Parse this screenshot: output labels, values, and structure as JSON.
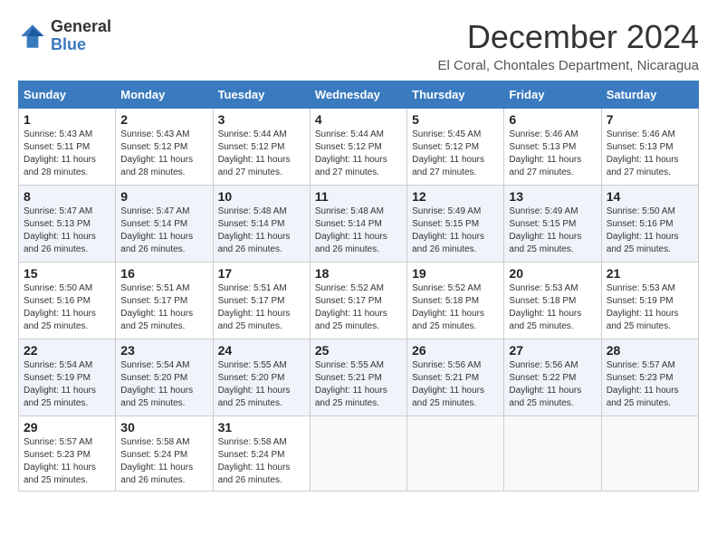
{
  "logo": {
    "general": "General",
    "blue": "Blue"
  },
  "title": "December 2024",
  "location": "El Coral, Chontales Department, Nicaragua",
  "days_of_week": [
    "Sunday",
    "Monday",
    "Tuesday",
    "Wednesday",
    "Thursday",
    "Friday",
    "Saturday"
  ],
  "weeks": [
    [
      {
        "day": "1",
        "sunrise": "5:43 AM",
        "sunset": "5:11 PM",
        "daylight": "11 hours and 28 minutes."
      },
      {
        "day": "2",
        "sunrise": "5:43 AM",
        "sunset": "5:12 PM",
        "daylight": "11 hours and 28 minutes."
      },
      {
        "day": "3",
        "sunrise": "5:44 AM",
        "sunset": "5:12 PM",
        "daylight": "11 hours and 27 minutes."
      },
      {
        "day": "4",
        "sunrise": "5:44 AM",
        "sunset": "5:12 PM",
        "daylight": "11 hours and 27 minutes."
      },
      {
        "day": "5",
        "sunrise": "5:45 AM",
        "sunset": "5:12 PM",
        "daylight": "11 hours and 27 minutes."
      },
      {
        "day": "6",
        "sunrise": "5:46 AM",
        "sunset": "5:13 PM",
        "daylight": "11 hours and 27 minutes."
      },
      {
        "day": "7",
        "sunrise": "5:46 AM",
        "sunset": "5:13 PM",
        "daylight": "11 hours and 27 minutes."
      }
    ],
    [
      {
        "day": "8",
        "sunrise": "5:47 AM",
        "sunset": "5:13 PM",
        "daylight": "11 hours and 26 minutes."
      },
      {
        "day": "9",
        "sunrise": "5:47 AM",
        "sunset": "5:14 PM",
        "daylight": "11 hours and 26 minutes."
      },
      {
        "day": "10",
        "sunrise": "5:48 AM",
        "sunset": "5:14 PM",
        "daylight": "11 hours and 26 minutes."
      },
      {
        "day": "11",
        "sunrise": "5:48 AM",
        "sunset": "5:14 PM",
        "daylight": "11 hours and 26 minutes."
      },
      {
        "day": "12",
        "sunrise": "5:49 AM",
        "sunset": "5:15 PM",
        "daylight": "11 hours and 26 minutes."
      },
      {
        "day": "13",
        "sunrise": "5:49 AM",
        "sunset": "5:15 PM",
        "daylight": "11 hours and 25 minutes."
      },
      {
        "day": "14",
        "sunrise": "5:50 AM",
        "sunset": "5:16 PM",
        "daylight": "11 hours and 25 minutes."
      }
    ],
    [
      {
        "day": "15",
        "sunrise": "5:50 AM",
        "sunset": "5:16 PM",
        "daylight": "11 hours and 25 minutes."
      },
      {
        "day": "16",
        "sunrise": "5:51 AM",
        "sunset": "5:17 PM",
        "daylight": "11 hours and 25 minutes."
      },
      {
        "day": "17",
        "sunrise": "5:51 AM",
        "sunset": "5:17 PM",
        "daylight": "11 hours and 25 minutes."
      },
      {
        "day": "18",
        "sunrise": "5:52 AM",
        "sunset": "5:17 PM",
        "daylight": "11 hours and 25 minutes."
      },
      {
        "day": "19",
        "sunrise": "5:52 AM",
        "sunset": "5:18 PM",
        "daylight": "11 hours and 25 minutes."
      },
      {
        "day": "20",
        "sunrise": "5:53 AM",
        "sunset": "5:18 PM",
        "daylight": "11 hours and 25 minutes."
      },
      {
        "day": "21",
        "sunrise": "5:53 AM",
        "sunset": "5:19 PM",
        "daylight": "11 hours and 25 minutes."
      }
    ],
    [
      {
        "day": "22",
        "sunrise": "5:54 AM",
        "sunset": "5:19 PM",
        "daylight": "11 hours and 25 minutes."
      },
      {
        "day": "23",
        "sunrise": "5:54 AM",
        "sunset": "5:20 PM",
        "daylight": "11 hours and 25 minutes."
      },
      {
        "day": "24",
        "sunrise": "5:55 AM",
        "sunset": "5:20 PM",
        "daylight": "11 hours and 25 minutes."
      },
      {
        "day": "25",
        "sunrise": "5:55 AM",
        "sunset": "5:21 PM",
        "daylight": "11 hours and 25 minutes."
      },
      {
        "day": "26",
        "sunrise": "5:56 AM",
        "sunset": "5:21 PM",
        "daylight": "11 hours and 25 minutes."
      },
      {
        "day": "27",
        "sunrise": "5:56 AM",
        "sunset": "5:22 PM",
        "daylight": "11 hours and 25 minutes."
      },
      {
        "day": "28",
        "sunrise": "5:57 AM",
        "sunset": "5:23 PM",
        "daylight": "11 hours and 25 minutes."
      }
    ],
    [
      {
        "day": "29",
        "sunrise": "5:57 AM",
        "sunset": "5:23 PM",
        "daylight": "11 hours and 25 minutes."
      },
      {
        "day": "30",
        "sunrise": "5:58 AM",
        "sunset": "5:24 PM",
        "daylight": "11 hours and 26 minutes."
      },
      {
        "day": "31",
        "sunrise": "5:58 AM",
        "sunset": "5:24 PM",
        "daylight": "11 hours and 26 minutes."
      },
      null,
      null,
      null,
      null
    ]
  ]
}
